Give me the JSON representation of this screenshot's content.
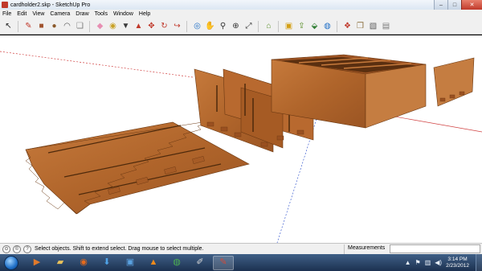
{
  "window": {
    "title": "cardholder2.skp - SketchUp Pro",
    "minimize_glyph": "–",
    "maximize_glyph": "□",
    "close_glyph": "✕"
  },
  "menu": [
    "File",
    "Edit",
    "View",
    "Camera",
    "Draw",
    "Tools",
    "Window",
    "Help"
  ],
  "toolbar": {
    "tools": [
      {
        "name": "select-tool-icon",
        "glyph": "↖",
        "color": "#222222"
      },
      {
        "name": "line-tool-icon",
        "glyph": "✎",
        "color": "#c0392b"
      },
      {
        "name": "rectangle-tool-icon",
        "glyph": "■",
        "color": "#a0522d"
      },
      {
        "name": "circle-tool-icon",
        "glyph": "●",
        "color": "#8b5a2b"
      },
      {
        "name": "arc-tool-icon",
        "glyph": "◠",
        "color": "#555555"
      },
      {
        "name": "make-component-icon",
        "glyph": "❏",
        "color": "#777777"
      },
      {
        "name": "eraser-icon",
        "glyph": "◆",
        "color": "#e78fb3"
      },
      {
        "name": "tape-measure-icon",
        "glyph": "◉",
        "color": "#c9a227"
      },
      {
        "name": "paint-bucket-icon",
        "glyph": "▼",
        "color": "#3a3a3a"
      },
      {
        "name": "push-pull-icon",
        "glyph": "▲",
        "color": "#c0392b"
      },
      {
        "name": "move-tool-icon",
        "glyph": "✥",
        "color": "#c0392b"
      },
      {
        "name": "rotate-tool-icon",
        "glyph": "↻",
        "color": "#c0392b"
      },
      {
        "name": "offset-tool-icon",
        "glyph": "↪",
        "color": "#c0392b"
      },
      {
        "name": "orbit-icon",
        "glyph": "◎",
        "color": "#1f6fc7"
      },
      {
        "name": "pan-icon",
        "glyph": "✋",
        "color": "#1f6fc7"
      },
      {
        "name": "zoom-icon",
        "glyph": "⚲",
        "color": "#333333"
      },
      {
        "name": "zoom-window-icon",
        "glyph": "⊕",
        "color": "#333333"
      },
      {
        "name": "zoom-extents-icon",
        "glyph": "⤢",
        "color": "#333333"
      },
      {
        "name": "previous-view-icon",
        "glyph": "⌂",
        "color": "#5a8f29"
      },
      {
        "name": "get-models-icon",
        "glyph": "▣",
        "color": "#d4a017"
      },
      {
        "name": "share-model-icon",
        "glyph": "⇪",
        "color": "#5a8f29"
      },
      {
        "name": "share-component-icon",
        "glyph": "⬙",
        "color": "#2e7d32"
      },
      {
        "name": "get-photo-texture-icon",
        "glyph": "◍",
        "color": "#1f6fc7"
      },
      {
        "name": "extension-warehouse-icon",
        "glyph": "❖",
        "color": "#c0392b"
      },
      {
        "name": "components-icon",
        "glyph": "❒",
        "color": "#8a6d3b"
      },
      {
        "name": "styles-icon",
        "glyph": "▧",
        "color": "#5a5a5a"
      },
      {
        "name": "layers-icon",
        "glyph": "▤",
        "color": "#7a7a7a"
      }
    ]
  },
  "viewport": {
    "background": "#ffffff",
    "wood_color": "#b5692e",
    "wood_dark": "#8e4d1d",
    "wood_light": "#cf8a4d"
  },
  "status": {
    "text": "Select objects. Shift to extend select. Drag mouse to select multiple.",
    "measurements_label": "Measurements",
    "measurements_value": ""
  },
  "taskbar": {
    "apps": [
      {
        "name": "media-player-icon",
        "glyph": "▶",
        "color": "#e07a2c"
      },
      {
        "name": "explorer-icon",
        "glyph": "▰",
        "color": "#e8c15a"
      },
      {
        "name": "firefox-icon",
        "glyph": "◉",
        "color": "#e56a1c"
      },
      {
        "name": "downloads-icon",
        "glyph": "⬇",
        "color": "#4fa3e8"
      },
      {
        "name": "media-center-icon",
        "glyph": "▣",
        "color": "#5aa1e0"
      },
      {
        "name": "vlc-icon",
        "glyph": "▲",
        "color": "#f08a1c"
      },
      {
        "name": "chrome-icon",
        "glyph": "◍",
        "color": "#4caf50"
      },
      {
        "name": "paint-icon",
        "glyph": "✐",
        "color": "#d8d8d8"
      },
      {
        "name": "sketchup-icon",
        "glyph": "✎",
        "color": "#d04a3a"
      }
    ],
    "time": "3:14 PM",
    "date": "2/23/2012",
    "tray_flag": "⚑",
    "tray_arrow": "▲",
    "tray_network": "▥",
    "tray_volume": "◀)"
  }
}
